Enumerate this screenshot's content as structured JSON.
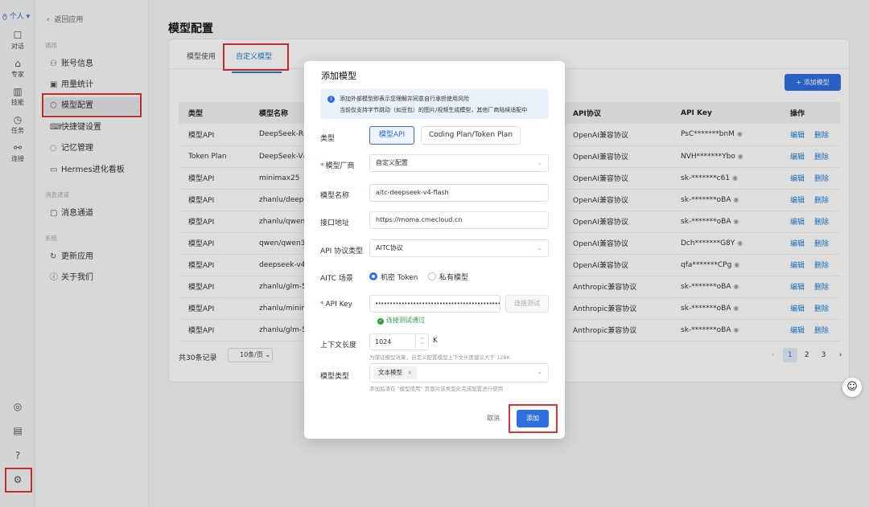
{
  "rail": {
    "workspace": "个人",
    "items": [
      {
        "label": "对话",
        "icon": "chat-icon"
      },
      {
        "label": "专家",
        "icon": "expert-icon"
      },
      {
        "label": "技能",
        "icon": "skill-icon"
      },
      {
        "label": "任务",
        "icon": "task-icon"
      },
      {
        "label": "连接",
        "icon": "connect-icon"
      }
    ],
    "bottom_icons": [
      "target-icon",
      "doc-icon",
      "help-icon",
      "gear-icon"
    ]
  },
  "menu": {
    "back": "返回应用",
    "sections": [
      {
        "title": "通用",
        "items": [
          {
            "label": "账号信息",
            "icon": "user-icon"
          },
          {
            "label": "用量统计",
            "icon": "chart-icon"
          },
          {
            "label": "模型配置",
            "icon": "model-icon"
          },
          {
            "label": "快捷键设置",
            "icon": "keyboard-icon"
          },
          {
            "label": "记忆管理",
            "icon": "memory-icon"
          },
          {
            "label": "Hermes进化看板",
            "icon": "monitor-icon"
          }
        ]
      },
      {
        "title": "消息通道",
        "items": [
          {
            "label": "消息通道",
            "icon": "message-icon"
          }
        ]
      },
      {
        "title": "系统",
        "items": [
          {
            "label": "更新应用",
            "icon": "update-icon"
          },
          {
            "label": "关于我们",
            "icon": "info-icon"
          }
        ]
      }
    ]
  },
  "page": {
    "title": "模型配置",
    "tabs": [
      "模型使用",
      "自定义模型"
    ],
    "add_button": "+ 添加模型",
    "columns": [
      "类型",
      "模型名称",
      "API协议",
      "API Key",
      "操作"
    ],
    "rows": [
      {
        "type": "模型API",
        "name": "DeepSeek-R1-",
        "protocol": "OpenAI兼容协议",
        "key": "PsC*******bnM"
      },
      {
        "type": "Token Plan",
        "name": "DeepSeek-V4-",
        "protocol": "OpenAI兼容协议",
        "key": "NVH*******Ybo"
      },
      {
        "type": "模型API",
        "name": "minimax25",
        "protocol": "OpenAI兼容协议",
        "key": "sk-*******c61"
      },
      {
        "type": "模型API",
        "name": "zhanlu/deeps",
        "protocol": "OpenAI兼容协议",
        "key": "sk-*******oBA"
      },
      {
        "type": "模型API",
        "name": "zhanlu/qwen3",
        "protocol": "OpenAI兼容协议",
        "key": "sk-*******oBA"
      },
      {
        "type": "模型API",
        "name": "qwen/qwen3.",
        "protocol": "OpenAI兼容协议",
        "key": "Dch*******G8Y"
      },
      {
        "type": "模型API",
        "name": "deepseek-v4-",
        "protocol": "OpenAI兼容协议",
        "key": "qfa*******CPg"
      },
      {
        "type": "模型API",
        "name": "zhanlu/glm-5.",
        "protocol": "Anthropic兼容协议",
        "key": "sk-*******oBA"
      },
      {
        "type": "模型API",
        "name": "zhanlu/minim",
        "protocol": "Anthropic兼容协议",
        "key": "sk-*******oBA"
      },
      {
        "type": "模型API",
        "name": "zhanlu/glm-5.",
        "protocol": "Anthropic兼容协议",
        "key": "sk-*******oBA"
      }
    ],
    "edit": "编辑",
    "delete": "删除",
    "total": "共30条记录",
    "page_size": "10条/页",
    "pages": [
      "1",
      "2",
      "3"
    ]
  },
  "modal": {
    "title": "添加模型",
    "notice_line1": "添加外部模型即表示您理解并同意自行承担使用风险",
    "notice_line2": "当前仅支持字节跳动（如豆包）的图片/视频生成模型，其他厂商陆续适配中",
    "type_label": "类型",
    "type_options": [
      "模型API",
      "Coding Plan/Token Plan"
    ],
    "vendor_label": "模型厂商",
    "vendor_value": "自定义配置",
    "name_label": "模型名称",
    "name_value": "aitc-deepseek-v4-flash",
    "endpoint_label": "接口地址",
    "endpoint_value": "https://moma.cmecloud.cn",
    "protocol_label": "API 协议类型",
    "protocol_value": "AITC协议",
    "scene_label": "AITC 场景",
    "scene_options": [
      "机密 Token",
      "私有模型"
    ],
    "key_label": "API Key",
    "key_value": "••••••••••••••••••••••••••••••••••••••••••••",
    "test_button": "连接测试",
    "test_ok": "连接测试通过",
    "ctx_label": "上下文长度",
    "ctx_value": "1024",
    "ctx_unit": "K",
    "ctx_hint": "为保证模型效果，自定义配置模型上下文长度建议大于 128K",
    "mtype_label": "模型类型",
    "mtype_tag": "文本模型",
    "mtype_hint": "添加后请在 \"模型使用\" 页面对该类型处完成配置进行使用",
    "cancel": "取消",
    "submit": "添加"
  },
  "colors": {
    "accent": "#2f6fe0",
    "highlight": "#e03131",
    "success": "#2f9e44"
  }
}
